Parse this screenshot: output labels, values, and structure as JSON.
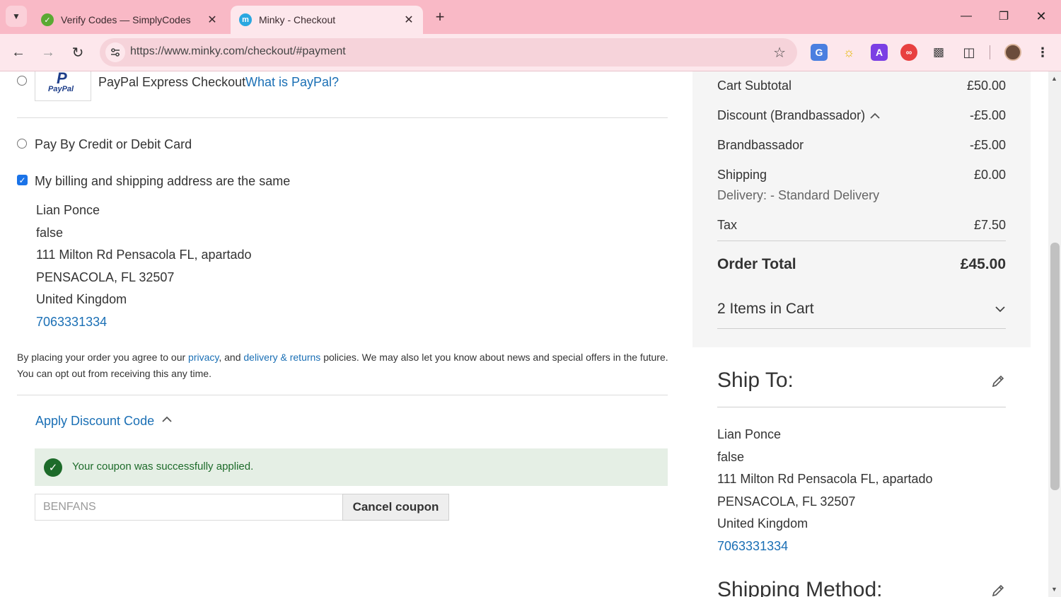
{
  "browser": {
    "tabs": [
      {
        "title": "Verify Codes — SimplyCodes",
        "active": false,
        "favicon_color": "#5aa932"
      },
      {
        "title": "Minky - Checkout",
        "active": true,
        "favicon_color": "#2aa7e0"
      }
    ],
    "url": "https://www.minky.com/checkout/#payment",
    "favicon_letter": "m",
    "extensions": [
      "translate-icon",
      "bulb-icon",
      "text-a-icon",
      "infinity-icon",
      "robot-icon",
      "puzzle-icon"
    ]
  },
  "payment": {
    "paypal_label": "PayPal Express Checkout",
    "paypal_link": "What is PayPal?",
    "paypal_logo_text": "PayPal",
    "card_label": "Pay By Credit or Debit Card",
    "same_address_label": "My billing and shipping address are the same",
    "same_address_checked": true
  },
  "billing_address": {
    "name": "Lian Ponce",
    "company": "false",
    "street": "111 Milton Rd Pensacola FL, apartado",
    "city_line": "PENSACOLA, FL 32507",
    "country": "United Kingdom",
    "phone": "7063331334"
  },
  "agreement": {
    "pre": "By placing your order you agree to our ",
    "privacy": "privacy",
    "mid": ", and ",
    "returns": "delivery & returns",
    "post": " policies. We may also let you know about news and special offers in the future.",
    "line2": "You can opt out from receiving this any time."
  },
  "discount": {
    "heading": "Apply Discount Code",
    "success_msg": "Your coupon was successfully applied.",
    "code_value": "BENFANS",
    "cancel_label": "Cancel coupon"
  },
  "summary": {
    "subtotal_label": "Cart Subtotal",
    "subtotal": "£50.00",
    "discount_label": "Discount (Brandbassador)",
    "discount": "-£5.00",
    "brand_label": "Brandbassador",
    "brand": "-£5.00",
    "shipping_label": "Shipping",
    "shipping": "£0.00",
    "delivery_label": "Delivery: - Standard Delivery",
    "tax_label": "Tax",
    "tax": "£7.50",
    "total_label": "Order Total",
    "total": "£45.00",
    "items_label": "2 Items in Cart"
  },
  "ship_to": {
    "heading": "Ship To:",
    "name": "Lian Ponce",
    "company": "false",
    "street": "111 Milton Rd Pensacola FL, apartado",
    "city_line": "PENSACOLA, FL 32507",
    "country": "United Kingdom",
    "phone": "7063331334"
  },
  "shipping_method": {
    "heading": "Shipping Method:"
  }
}
